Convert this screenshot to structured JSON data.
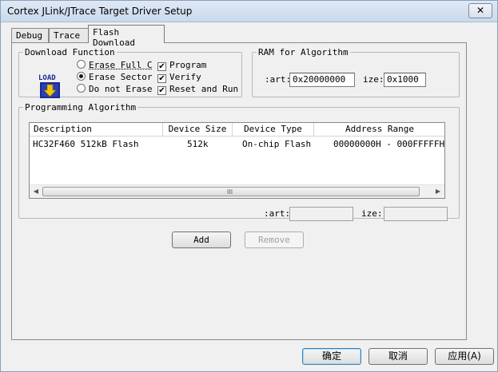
{
  "window": {
    "title": "Cortex JLink/JTrace Target Driver Setup",
    "close_glyph": "✕"
  },
  "tabs": [
    {
      "label": "Debug"
    },
    {
      "label": "Trace"
    },
    {
      "label": "Flash Download",
      "active": true
    }
  ],
  "download_function": {
    "legend": "Download Function",
    "load_icon_text": "LOAD",
    "erase_options": [
      {
        "label": "Erase Full C",
        "selected": false
      },
      {
        "label": "Erase Sector",
        "selected": true
      },
      {
        "label": "Do not Erase",
        "selected": false
      }
    ],
    "checks": [
      {
        "label": "Program",
        "checked": true
      },
      {
        "label": "Verify",
        "checked": true
      },
      {
        "label": "Reset and Run",
        "checked": true
      }
    ]
  },
  "ram_for_algorithm": {
    "legend": "RAM for Algorithm",
    "start_label": ":art:",
    "start_value": "0x20000000",
    "size_label": "ize:",
    "size_value": "0x1000"
  },
  "programming_algorithm": {
    "legend": "Programming Algorithm",
    "columns": [
      "Description",
      "Device Size",
      "Device Type",
      "Address Range"
    ],
    "rows": [
      {
        "description": "HC32F460 512kB Flash",
        "device_size": "512k",
        "device_type": "On-chip Flash",
        "address_range": "00000000H - 000FFFFFH"
      }
    ],
    "scroll_grip": "III",
    "start_label": ":art:",
    "start_value": "",
    "size_label": "ize:",
    "size_value": ""
  },
  "buttons": {
    "add": "Add",
    "remove": "Remove",
    "ok": "确定",
    "cancel": "取消",
    "apply": "应用(A)"
  },
  "colors": {
    "title_bar": "#c9d9ec",
    "dialog_bg": "#f0f0f0",
    "default_button_border": "#3c7fb1"
  }
}
